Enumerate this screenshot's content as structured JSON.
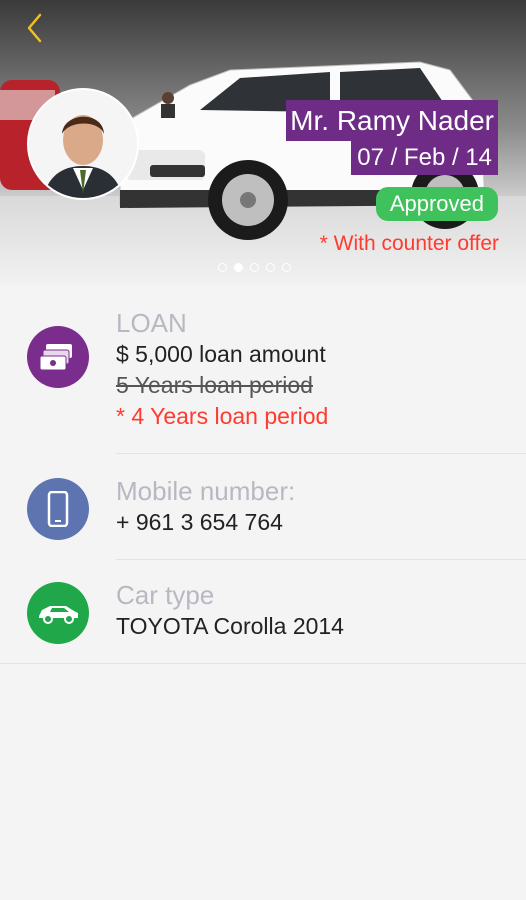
{
  "header": {
    "back_icon": "chevron-left-icon",
    "applicant_name": "Mr. Ramy Nader",
    "date": "07 / Feb / 14",
    "status_badge": "Approved",
    "counter_offer_note": "* With counter offer",
    "carousel": {
      "total": 5,
      "active_index": 1
    },
    "colors": {
      "name_bg": "#6e2c86",
      "approved_bg": "#3fc25c",
      "note": "#ff3b30",
      "back_icon": "#f2c21b"
    }
  },
  "details": {
    "loan": {
      "icon": "money-stack-icon",
      "icon_color": "#7b2d8e",
      "label": "LOAN",
      "amount": "$ 5,000 loan amount",
      "original_period": "5 Years loan period",
      "counter_period": "* 4 Years loan period"
    },
    "mobile": {
      "icon": "smartphone-icon",
      "icon_color": "#5d74b0",
      "label": "Mobile number:",
      "value": "+ 961 3 654 764"
    },
    "car": {
      "icon": "car-icon",
      "icon_color": "#1fa74a",
      "label": "Car type",
      "value": "TOYOTA Corolla 2014"
    }
  }
}
